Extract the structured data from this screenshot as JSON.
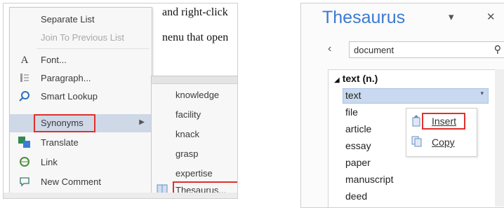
{
  "left": {
    "doc_lines": [
      "and right-click",
      "nenu that open"
    ],
    "context_menu": {
      "items": [
        {
          "label": "Separate List",
          "disabled": false,
          "icon": ""
        },
        {
          "label": "Join To Previous List",
          "disabled": true,
          "icon": ""
        },
        {
          "label": "Font...",
          "disabled": false,
          "icon": "font-icon"
        },
        {
          "label": "Paragraph...",
          "disabled": false,
          "icon": "paragraph-icon"
        },
        {
          "label": "Smart Lookup",
          "disabled": false,
          "icon": "smart-lookup-icon"
        },
        {
          "label": "Synonyms",
          "disabled": false,
          "icon": ""
        },
        {
          "label": "Translate",
          "disabled": false,
          "icon": "translate-icon"
        },
        {
          "label": "Link",
          "disabled": false,
          "icon": "link-icon"
        },
        {
          "label": "New Comment",
          "disabled": false,
          "icon": "comment-icon"
        }
      ]
    },
    "synonyms_submenu": {
      "items": [
        "knowledge",
        "facility",
        "knack",
        "grasp",
        "expertise"
      ],
      "thesaurus_label": "Thesaurus..."
    }
  },
  "right": {
    "pane_title": "Thesaurus",
    "search_value": "document",
    "group_label": "text (n.)",
    "words": [
      "text",
      "file",
      "article",
      "essay",
      "paper",
      "manuscript",
      "deed"
    ],
    "selected_word": "text",
    "popup": {
      "insert_label": "Insert",
      "copy_label": "Copy"
    }
  },
  "colors": {
    "highlight_box": "#e0302a",
    "title_blue": "#3b7ad2",
    "selection": "#c9d9ef"
  }
}
